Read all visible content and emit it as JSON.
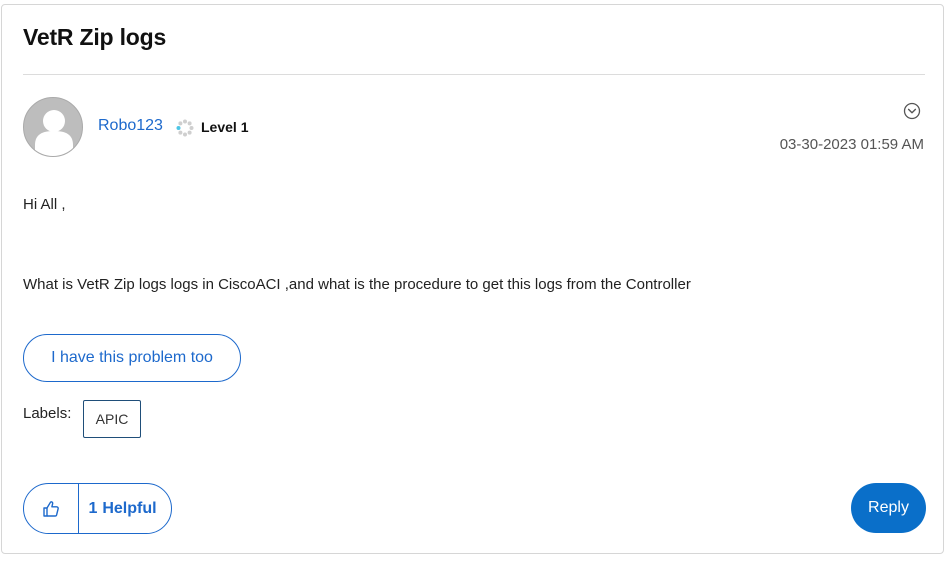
{
  "post": {
    "title": "VetR Zip logs",
    "author": "Robo123",
    "rank": "Level 1",
    "timestamp": "03-30-2023 01:59 AM",
    "body": [
      "Hi All ,",
      "What is VetR Zip logs logs in CiscoACI ,and what is the procedure to get this logs from the Controller"
    ]
  },
  "actions": {
    "problem_label": "I have this problem too",
    "reply_label": "Reply"
  },
  "labels": {
    "title": "Labels:",
    "items": [
      "APIC"
    ]
  },
  "kudos": {
    "count": "1",
    "label": "Helpful"
  },
  "icons": {
    "avatar": "user-silhouette-icon",
    "rank": "spinner-dots-icon",
    "menu": "chevron-down-circle-icon",
    "like": "thumbs-up-icon"
  },
  "colors": {
    "link": "#1d69cc",
    "reply_bg": "#0a6fc9",
    "label_border": "#1f4e79"
  }
}
